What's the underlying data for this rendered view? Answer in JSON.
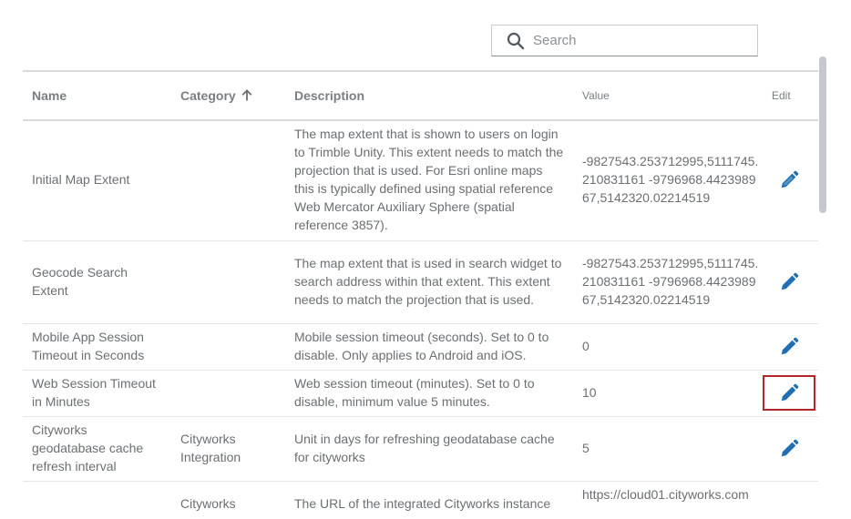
{
  "search": {
    "placeholder": "Search",
    "value": ""
  },
  "table": {
    "headers": {
      "name": "Name",
      "category": "Category",
      "description": "Description",
      "value": "Value",
      "edit": "Edit"
    },
    "sort": {
      "column": "Category",
      "direction": "ascending"
    },
    "rows": [
      {
        "name": "Initial Map Extent",
        "category": "",
        "description": "The map extent that is shown to users on login to Trimble Unity. This extent needs to match the projection that is used. For Esri online maps this is typically defined using spatial reference Web Mercator Auxiliary Sphere (spatial reference 3857).",
        "value": "-9827543.253712995,5111745.210831161 -9796968.442398967,5142320.02214519"
      },
      {
        "name": "Geocode Search Extent",
        "category": "",
        "description": "The map extent that is used in search widget to search address within that extent. This extent needs to match the projection that is used.",
        "value": "-9827543.253712995,5111745.210831161 -9796968.442398967,5142320.02214519"
      },
      {
        "name": "Mobile App Session Timeout in Seconds",
        "category": "",
        "description": "Mobile session timeout (seconds). Set to 0 to disable. Only applies to Android and iOS.",
        "value": "0"
      },
      {
        "name": "Web Session Timeout in Minutes",
        "category": "",
        "description": "Web session timeout (minutes). Set to 0 to disable, minimum value 5 minutes.",
        "value": "10"
      },
      {
        "name": "Cityworks geodatabase cache refresh interval",
        "category": "Cityworks Integration",
        "description": "Unit in days for refreshing geodatabase cache for cityworks",
        "value": "5"
      },
      {
        "name": "",
        "category": "Cityworks",
        "description": "The URL of the integrated Cityworks instance",
        "value": "https://cloud01.cityworks.com"
      }
    ]
  },
  "colors": {
    "accent": "#1f6fb2",
    "highlight": "#b5262b",
    "text": "#6b6f73"
  }
}
